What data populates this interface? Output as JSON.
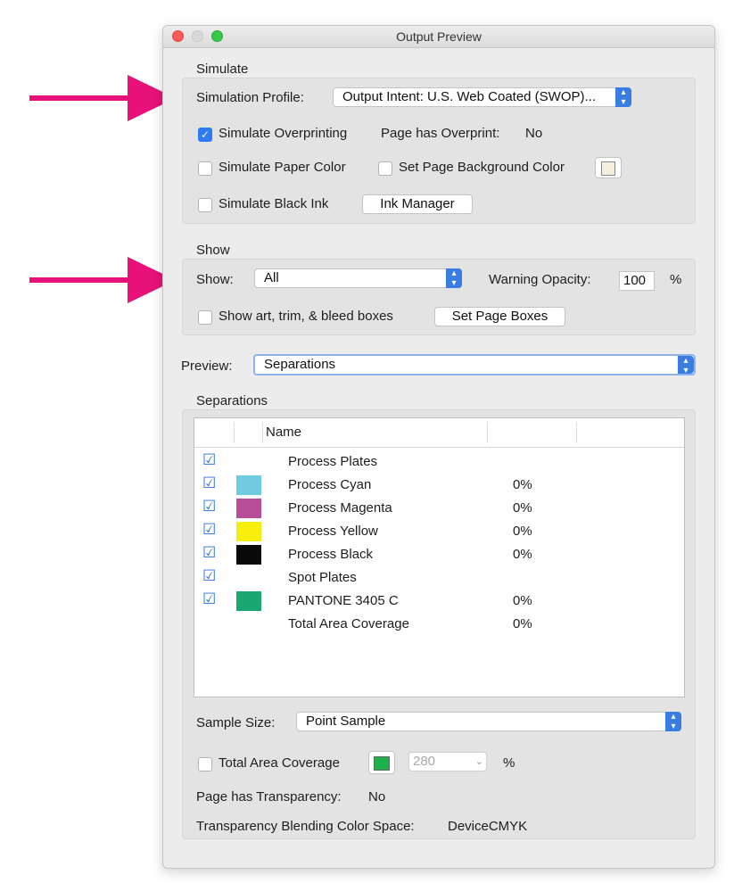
{
  "window": {
    "title": "Output Preview"
  },
  "simulate": {
    "section_label": "Simulate",
    "profile_label": "Simulation Profile:",
    "profile_value": "Output Intent: U.S. Web Coated (SWOP)...",
    "overprinting_label": "Simulate Overprinting",
    "overprinting_checked": true,
    "page_overprint_label": "Page has Overprint:",
    "page_overprint_value": "No",
    "paper_color_label": "Simulate Paper Color",
    "page_bg_label": "Set Page Background Color",
    "page_bg_color": "#f3efdc",
    "black_ink_label": "Simulate Black Ink",
    "ink_manager_label": "Ink Manager"
  },
  "show": {
    "section_label": "Show",
    "show_label": "Show:",
    "show_value": "All",
    "warning_label": "Warning Opacity:",
    "warning_value": "100",
    "warning_unit": "%",
    "boxes_label": "Show art, trim, & bleed boxes",
    "set_boxes_label": "Set Page Boxes"
  },
  "preview": {
    "label": "Preview:",
    "value": "Separations"
  },
  "separations": {
    "section_label": "Separations",
    "header_name": "Name",
    "rows": [
      {
        "name": "Process Plates",
        "checked": true,
        "color": "",
        "value": ""
      },
      {
        "name": "Process Cyan",
        "checked": true,
        "color": "#6fcce0",
        "value": "0%"
      },
      {
        "name": "Process Magenta",
        "checked": true,
        "color": "#b84d98",
        "value": "0%"
      },
      {
        "name": "Process Yellow",
        "checked": true,
        "color": "#f7ee0c",
        "value": "0%"
      },
      {
        "name": "Process Black",
        "checked": true,
        "color": "#0a0a0a",
        "value": "0%"
      },
      {
        "name": "Spot Plates",
        "checked": true,
        "color": "",
        "value": ""
      },
      {
        "name": "PANTONE 3405 C",
        "checked": true,
        "color": "#1aa872",
        "value": "0%"
      },
      {
        "name": "Total Area Coverage",
        "checked": false,
        "color": "",
        "value": "0%"
      }
    ],
    "sample_label": "Sample Size:",
    "sample_value": "Point Sample",
    "tac_label": "Total Area Coverage",
    "tac_color": "#1db14a",
    "tac_value": "280",
    "tac_unit": "%",
    "transparency_label": "Page has Transparency:",
    "transparency_value": "No",
    "blend_label": "Transparency Blending Color Space:",
    "blend_value": "DeviceCMYK"
  },
  "annotations": {
    "arrow_color": "#e8117a"
  }
}
